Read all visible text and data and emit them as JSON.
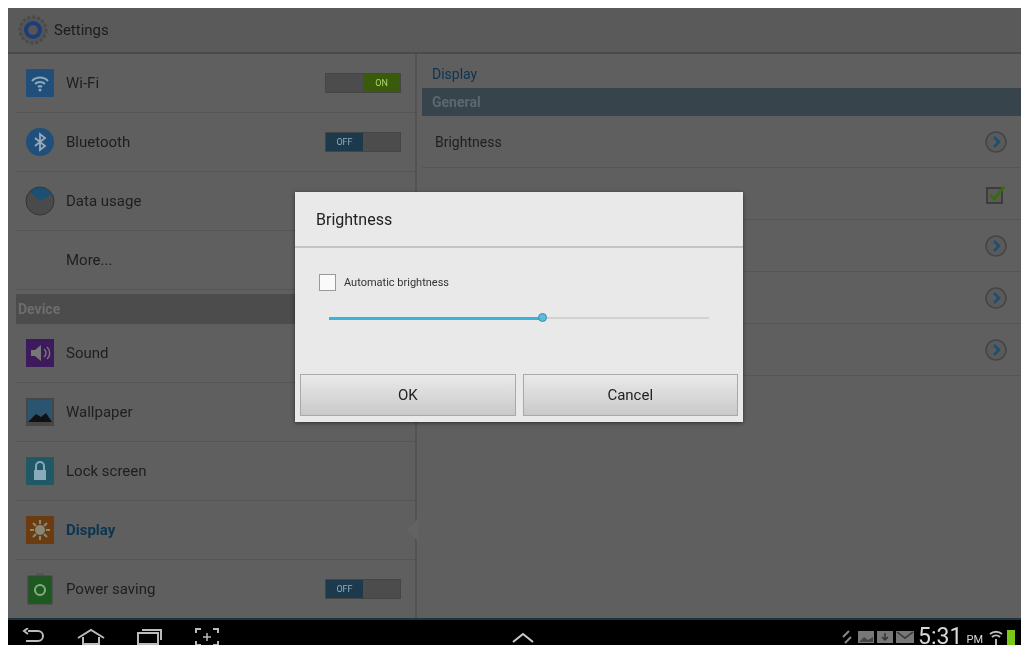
{
  "app_bar": {
    "title": "Settings"
  },
  "sidebar": {
    "items": [
      {
        "kind": "toggle",
        "label": "Wi-Fi",
        "on": true,
        "switch_text": "ON",
        "selected": false
      },
      {
        "kind": "toggle",
        "label": "Bluetooth",
        "on": false,
        "switch_text": "OFF",
        "selected": false
      },
      {
        "kind": "plain",
        "label": "Data usage",
        "selected": false
      },
      {
        "kind": "plain",
        "label": "More...",
        "selected": false
      },
      {
        "kind": "header",
        "label": "Device"
      },
      {
        "kind": "plain",
        "label": "Sound",
        "selected": false
      },
      {
        "kind": "plain",
        "label": "Wallpaper",
        "selected": false
      },
      {
        "kind": "plain",
        "label": "Lock screen",
        "selected": false
      },
      {
        "kind": "plain",
        "label": "Display",
        "selected": true
      },
      {
        "kind": "toggle",
        "label": "Power saving",
        "on": false,
        "switch_text": "OFF",
        "selected": false
      }
    ]
  },
  "detail": {
    "title": "Display",
    "section": "General",
    "rows": [
      {
        "kind": "arrow",
        "label": "Brightness"
      },
      {
        "kind": "check",
        "checked": true
      },
      {
        "kind": "arrow"
      },
      {
        "kind": "arrow"
      },
      {
        "kind": "arrow"
      }
    ]
  },
  "dialog": {
    "title": "Brightness",
    "auto_checkbox": {
      "label": "Automatic brightness",
      "checked": false
    },
    "slider": {
      "level": 0.56
    },
    "buttons": [
      "OK",
      "Cancel"
    ]
  },
  "nav_bar": {
    "time": "5:31",
    "ampm": "PM"
  }
}
